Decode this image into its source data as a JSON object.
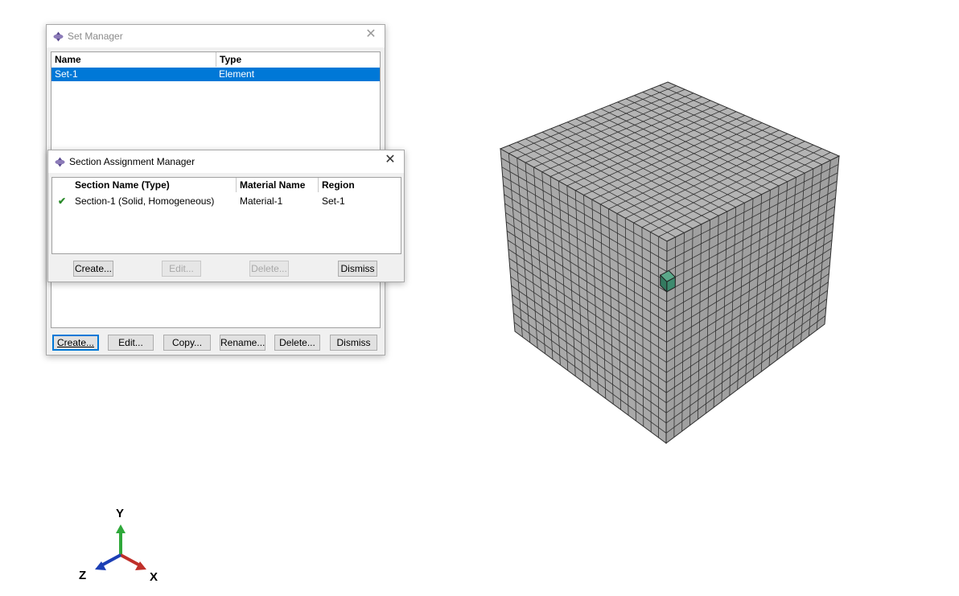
{
  "set_manager": {
    "title": "Set Manager",
    "columns": [
      "Name",
      "Type"
    ],
    "rows": [
      {
        "name": "Set-1",
        "type": "Element",
        "selected": true
      }
    ],
    "buttons": {
      "create": "Create...",
      "edit": "Edit...",
      "copy": "Copy...",
      "rename": "Rename...",
      "delete": "Delete...",
      "dismiss": "Dismiss"
    }
  },
  "section_assignment_manager": {
    "title": "Section Assignment Manager",
    "columns": [
      "Section Name (Type)",
      "Material Name",
      "Region"
    ],
    "rows": [
      {
        "status": "✔",
        "section": "Section-1 (Solid, Homogeneous)",
        "material": "Material-1",
        "region": "Set-1"
      }
    ],
    "buttons": {
      "create": "Create...",
      "edit": "Edit...",
      "delete": "Delete...",
      "dismiss": "Dismiss"
    }
  },
  "viewport": {
    "mesh_color": "#a9a9a9",
    "highlight_color": "#3d8a6e",
    "triad": {
      "x_label": "X",
      "y_label": "Y",
      "z_label": "Z"
    }
  },
  "colors": {
    "selection": "#0078d7",
    "x_axis": "#c0302a",
    "y_axis": "#2fa83a",
    "z_axis": "#1c3fb5",
    "check": "#2a8a2a"
  }
}
